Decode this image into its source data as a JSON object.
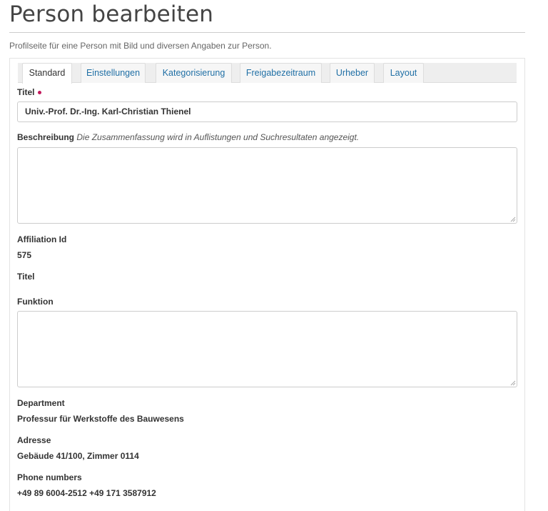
{
  "page": {
    "title": "Person bearbeiten",
    "description": "Profilseite für eine Person mit Bild und diversen Angaben zur Person."
  },
  "tabs": [
    {
      "label": "Standard",
      "active": true
    },
    {
      "label": "Einstellungen",
      "active": false
    },
    {
      "label": "Kategorisierung",
      "active": false
    },
    {
      "label": "Freigabezeitraum",
      "active": false
    },
    {
      "label": "Urheber",
      "active": false
    },
    {
      "label": "Layout",
      "active": false
    }
  ],
  "form": {
    "titel_label": "Titel",
    "titel_value": "Univ.-Prof. Dr.-Ing. Karl-Christian Thienel",
    "beschreibung_label": "Beschreibung",
    "beschreibung_hint": "Die Zusammenfassung wird in Auflistungen und Suchresultaten angezeigt.",
    "beschreibung_value": "",
    "affiliation_label": "Affiliation Id",
    "affiliation_value": "575",
    "titel2_label": "Titel",
    "funktion_label": "Funktion",
    "funktion_value": "",
    "department_label": "Department",
    "department_value": "Professur für Werkstoffe des Bauwesens",
    "adresse_label": "Adresse",
    "adresse_value": "Gebäude 41/100, Zimmer 0114",
    "phone_label": "Phone numbers",
    "phone_value": "+49 89 6004-2512 +49 171 3587912"
  },
  "colors": {
    "tab_link": "#1f6fa5",
    "required": "#c2185b"
  }
}
